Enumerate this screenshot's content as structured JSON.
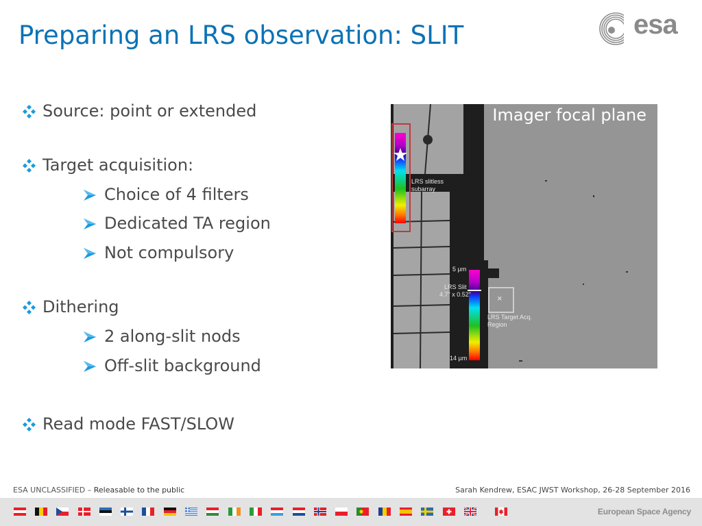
{
  "slide": {
    "title": "Preparing an LRS observation: SLIT",
    "logo_text": "esa",
    "bullets": [
      {
        "level": 1,
        "text": "Source: point or extended"
      },
      {
        "level": 1,
        "text": "Target acquisition:"
      },
      {
        "level": 2,
        "text": "Choice of 4 filters"
      },
      {
        "level": 2,
        "text": "Dedicated TA region"
      },
      {
        "level": 2,
        "text": "Not compulsory"
      },
      {
        "level": 1,
        "text": "Dithering"
      },
      {
        "level": 2,
        "text": "2 along-slit nods"
      },
      {
        "level": 2,
        "text": "Off-slit background"
      },
      {
        "level": 1,
        "text": "Read mode FAST/SLOW"
      }
    ],
    "figure": {
      "title": "Imager focal plane",
      "slitless_label_1": "LRS slitless",
      "slitless_label_2": "subarray",
      "wave_short": "5 µm",
      "wave_long": "14 µm",
      "slit_label_1": "LRS Slit",
      "slit_label_2": "4.7\" x 0.52\"",
      "ta_label_1": "LRS Target Acq.",
      "ta_label_2": "Region",
      "ta_marker": "×",
      "highlight_color": "#c0393b"
    }
  },
  "footer": {
    "classification": "ESA UNCLASSIFIED",
    "separator": " – ",
    "release": "Releasable to the public",
    "credit": "Sarah Kendrew, ESAC JWST Workshop, 26-28 September 2016",
    "agency": "European Space Agency",
    "flags": [
      "Austria",
      "Belgium",
      "Czech Republic",
      "Denmark",
      "Estonia",
      "Finland",
      "France",
      "Germany",
      "Greece",
      "Hungary",
      "Ireland",
      "Italy",
      "Luxembourg",
      "Netherlands",
      "Norway",
      "Poland",
      "Portugal",
      "Romania",
      "Spain",
      "Sweden",
      "Switzerland",
      "United Kingdom",
      "Canada"
    ]
  },
  "colors": {
    "title": "#0b72b5",
    "bullet_marker": "#1a9be0",
    "body_text": "#4a4a4a"
  }
}
